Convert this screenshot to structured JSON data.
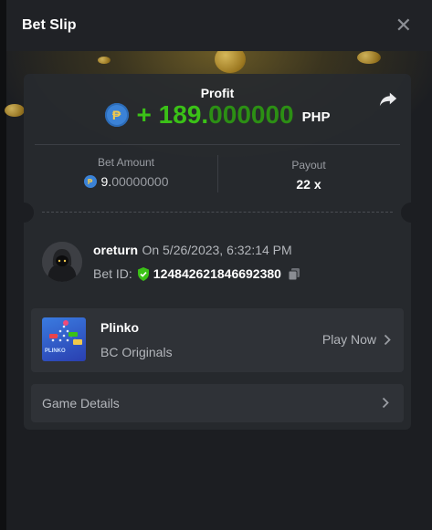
{
  "header": {
    "title": "Bet Slip",
    "close_icon": "close-icon"
  },
  "profit": {
    "label": "Profit",
    "sign": "+ ",
    "value_main": "189.",
    "value_decimals": "000000",
    "currency": "PHP",
    "coin_symbol": "₱",
    "color": "#3bc117"
  },
  "bet_amount": {
    "label": "Bet Amount",
    "value_main": "9.",
    "value_decimals": "00000000"
  },
  "payout": {
    "label": "Payout",
    "value": "22 x"
  },
  "user": {
    "name": "oreturn",
    "date_text": "On 5/26/2023, 6:32:14 PM",
    "bet_id_label": "Bet ID:",
    "bet_id": "124842621846692380"
  },
  "game": {
    "name": "Plinko",
    "provider": "BC Originals",
    "play_label": "Play Now",
    "thumb_text": "PLINKO"
  },
  "details": {
    "label": "Game Details"
  }
}
